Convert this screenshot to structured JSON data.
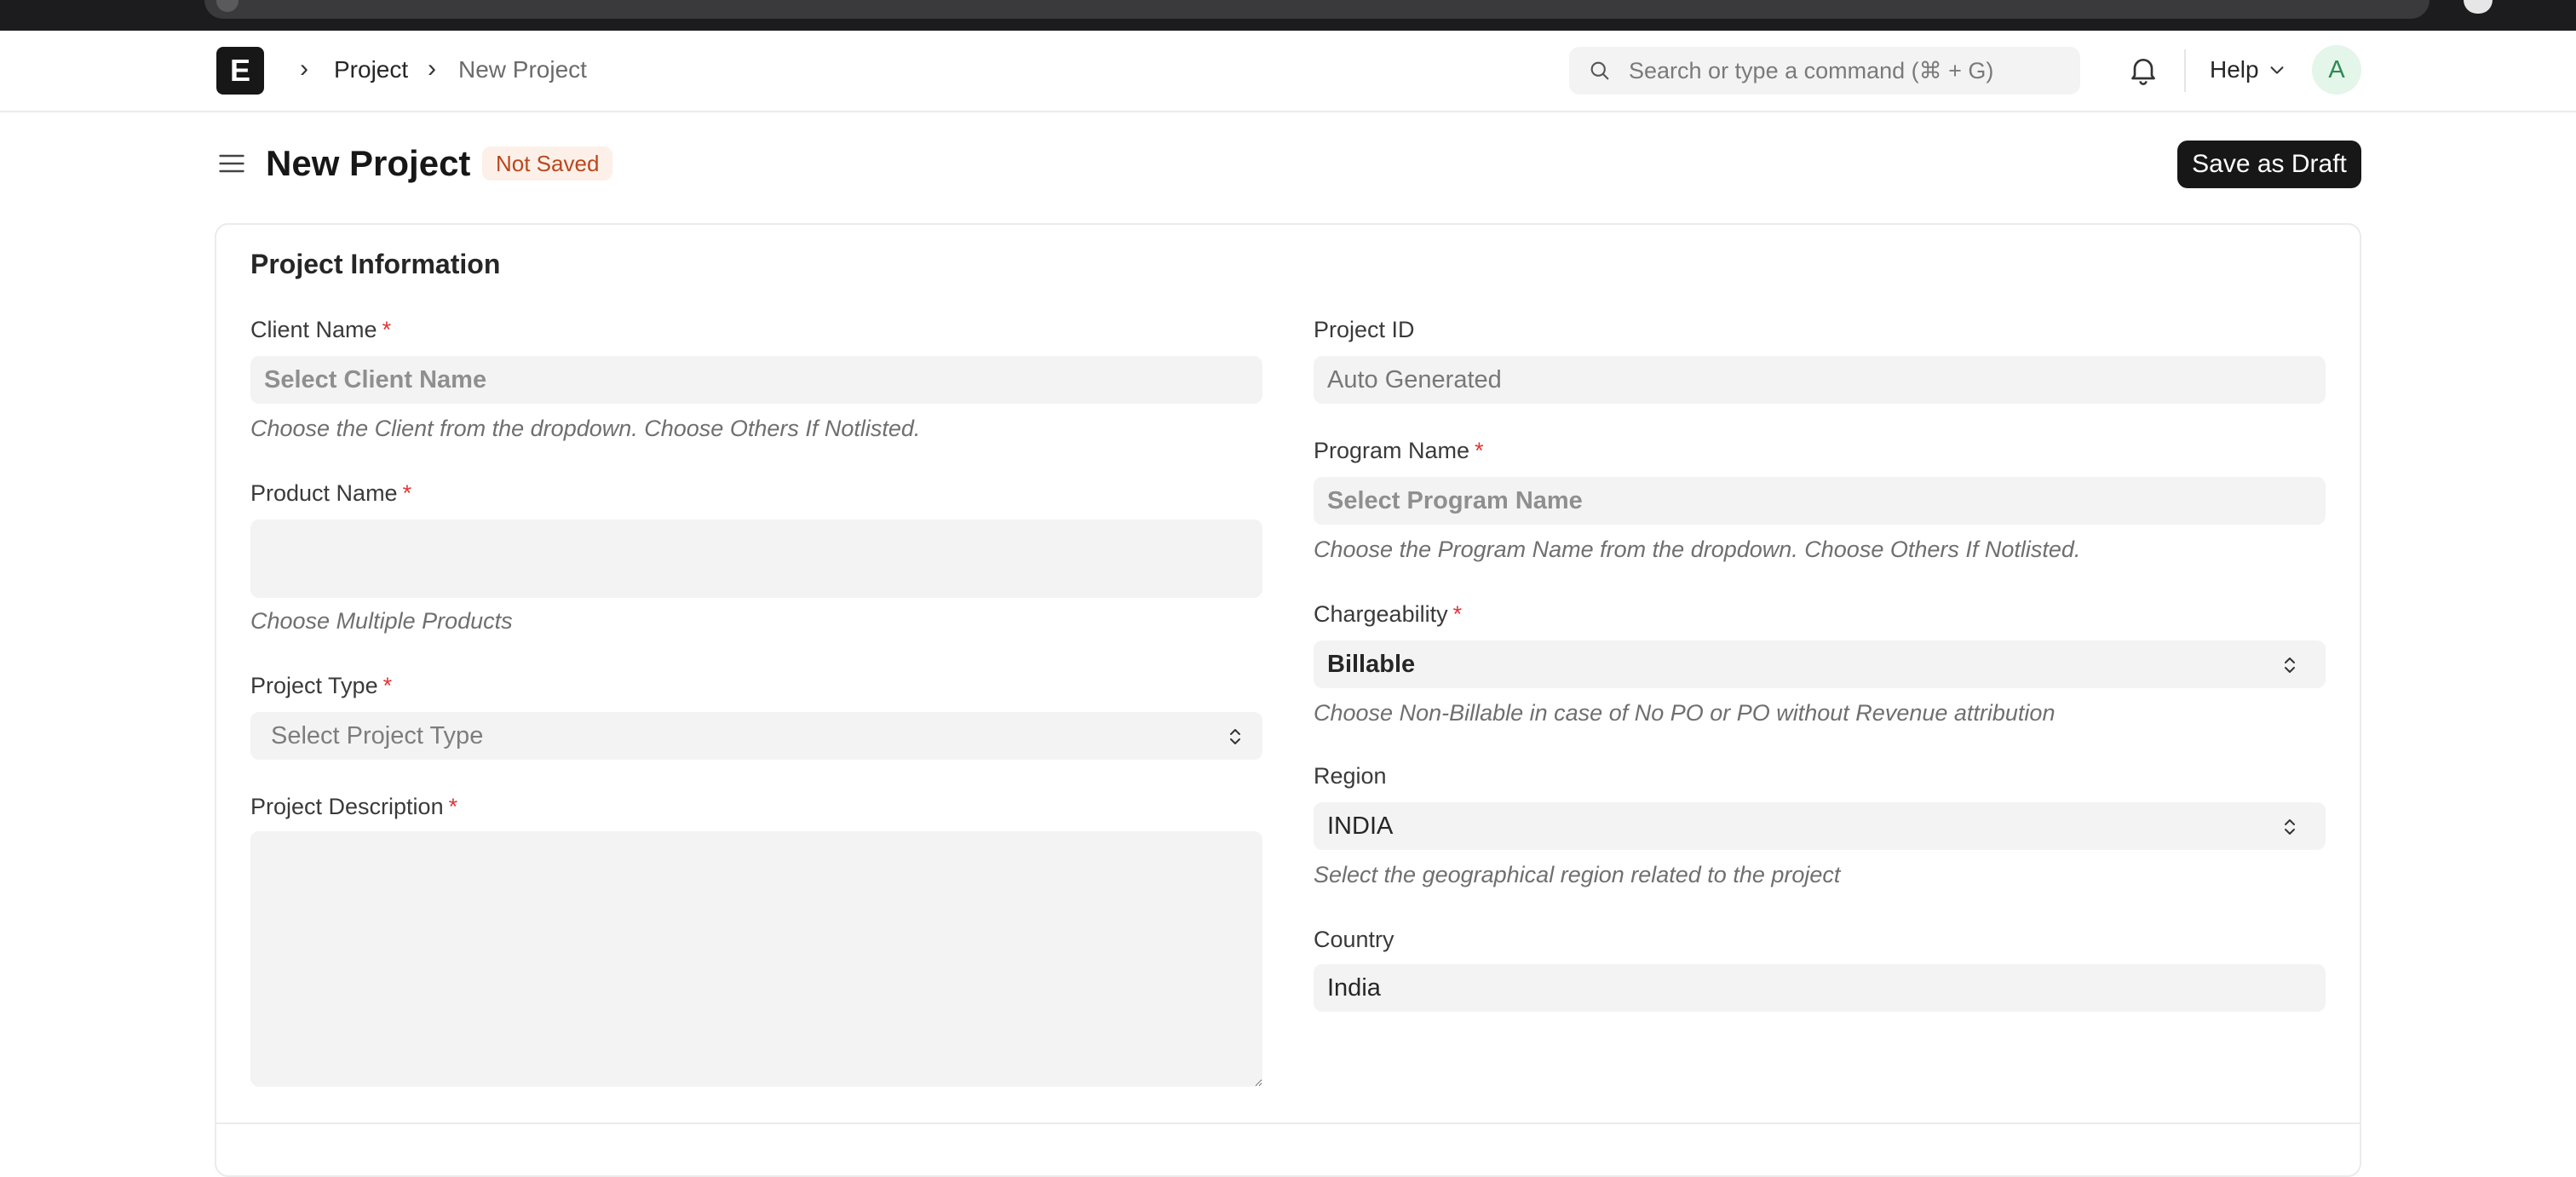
{
  "navbar": {
    "logo_letter": "E",
    "breadcrumbs": [
      "Project",
      "New Project"
    ],
    "search_placeholder": "Search or type a command (⌘ + G)",
    "help_label": "Help",
    "avatar_initial": "A"
  },
  "page": {
    "title": "New Project",
    "status": "Not Saved",
    "save_button": "Save as Draft"
  },
  "section": {
    "title": "Project Information"
  },
  "fields": {
    "client_name": {
      "label": "Client Name",
      "required": "*",
      "placeholder": "Select Client Name",
      "hint": "Choose the Client from the dropdown. Choose Others If Notlisted."
    },
    "product_name": {
      "label": "Product Name",
      "required": "*",
      "hint": "Choose Multiple Products"
    },
    "project_type": {
      "label": "Project Type",
      "required": "*",
      "placeholder": "Select Project Type"
    },
    "project_description": {
      "label": "Project Description",
      "required": "*"
    },
    "project_id": {
      "label": "Project ID",
      "placeholder": "Auto Generated"
    },
    "program_name": {
      "label": "Program Name",
      "required": "*",
      "placeholder": "Select Program Name",
      "hint": "Choose the Program Name from the dropdown. Choose Others If Notlisted."
    },
    "chargeability": {
      "label": "Chargeability",
      "required": "*",
      "value": "Billable",
      "hint": "Choose Non-Billable in case of No PO or PO without Revenue attribution"
    },
    "region": {
      "label": "Region",
      "value": "INDIA",
      "hint": "Select the geographical region related to the project"
    },
    "country": {
      "label": "Country",
      "value": "India"
    }
  }
}
